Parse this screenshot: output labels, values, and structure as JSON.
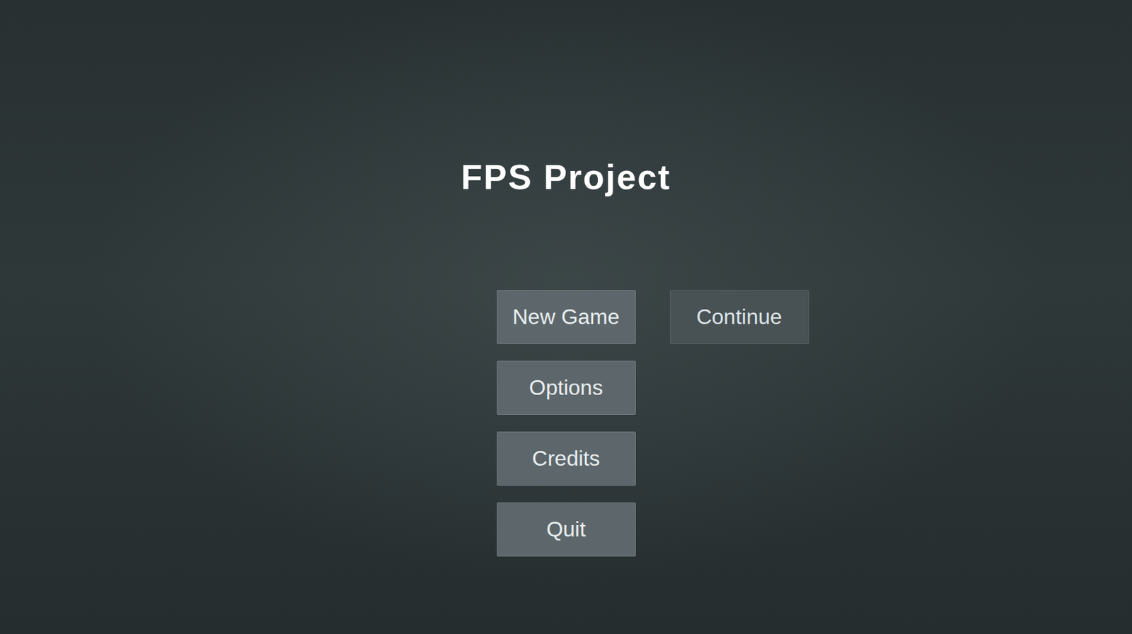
{
  "title": "FPS Project",
  "menu": [
    {
      "label": "New Game",
      "disabled": false
    },
    {
      "label": "Options",
      "disabled": false
    },
    {
      "label": "Credits",
      "disabled": false
    },
    {
      "label": "Quit",
      "disabled": false
    }
  ],
  "continue_button": {
    "label": "Continue",
    "disabled": true
  }
}
